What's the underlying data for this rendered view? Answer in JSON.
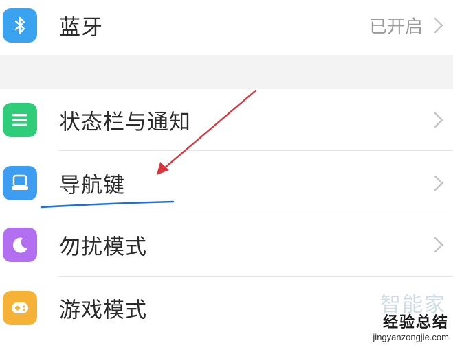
{
  "settings": {
    "bluetooth": {
      "label": "蓝牙",
      "value": "已开启",
      "icon": "bluetooth-icon",
      "color": "#3aa3f0"
    },
    "status_bar": {
      "label": "状态栏与通知",
      "icon": "status-bar-icon",
      "color": "#2fcc7a"
    },
    "nav_keys": {
      "label": "导航键",
      "icon": "navigation-keys-icon",
      "color": "#3d9df0"
    },
    "dnd": {
      "label": "勿扰模式",
      "icon": "moon-icon",
      "color": "#b26ff0"
    },
    "game_mode": {
      "label": "游戏模式",
      "icon": "gamepad-icon",
      "color": "#f6b236"
    }
  },
  "annotation": {
    "arrow_color": "#d9363e",
    "underline_color": "#1f6fd6"
  },
  "watermark": {
    "brand": "经验总结",
    "faint": "智能家",
    "url": "jingyanzongjie.com"
  }
}
